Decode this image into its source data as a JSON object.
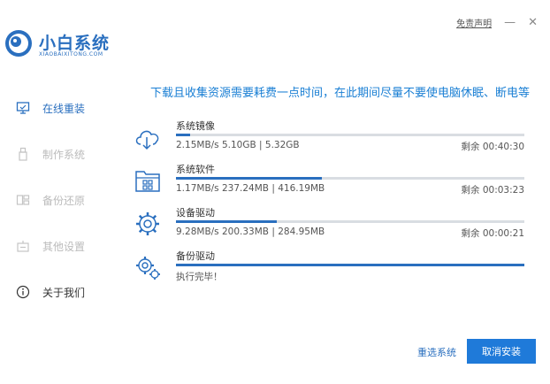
{
  "app": {
    "name": "小白系统",
    "subtitle": "XIAOBAIXITONG.COM"
  },
  "topbar": {
    "disclaimer": "免责声明",
    "minimize_glyph": "—",
    "close_glyph": "✕"
  },
  "sidebar": {
    "items": [
      {
        "label": "在线重装",
        "icon": "monitor-icon",
        "state": "active"
      },
      {
        "label": "制作系统",
        "icon": "usb-icon",
        "state": "disabled"
      },
      {
        "label": "备份还原",
        "icon": "backup-icon",
        "state": "disabled"
      },
      {
        "label": "其他设置",
        "icon": "settings-box-icon",
        "state": "disabled"
      },
      {
        "label": "关于我们",
        "icon": "info-icon",
        "state": "normal"
      }
    ]
  },
  "main": {
    "headline": "下载且收集资源需要耗费一点时间，在此期间尽量不要使电脑休眠、断电等",
    "tasks": [
      {
        "name": "系统镜像",
        "icon": "cloud-download-icon",
        "stats": "2.15MB/s 5.10GB | 5.32GB",
        "remaining": "剩余 00:40:30",
        "progress": 0.04
      },
      {
        "name": "系统软件",
        "icon": "app-window-icon",
        "stats": "1.17MB/s 237.24MB | 416.19MB",
        "remaining": "剩余 00:03:23",
        "progress": 0.42
      },
      {
        "name": "设备驱动",
        "icon": "gear-icon",
        "stats": "9.28MB/s 200.33MB | 284.95MB",
        "remaining": "剩余 00:00:21",
        "progress": 0.29
      },
      {
        "name": "备份驱动",
        "icon": "gears-icon",
        "stats": "执行完毕！",
        "remaining": "",
        "progress": 1.0
      }
    ]
  },
  "footer": {
    "reselect": "重选系统",
    "cancel": "取消安装"
  },
  "colors": {
    "accent": "#2a6fbf",
    "headline": "#1a7fd4",
    "button": "#1f7ad9"
  }
}
